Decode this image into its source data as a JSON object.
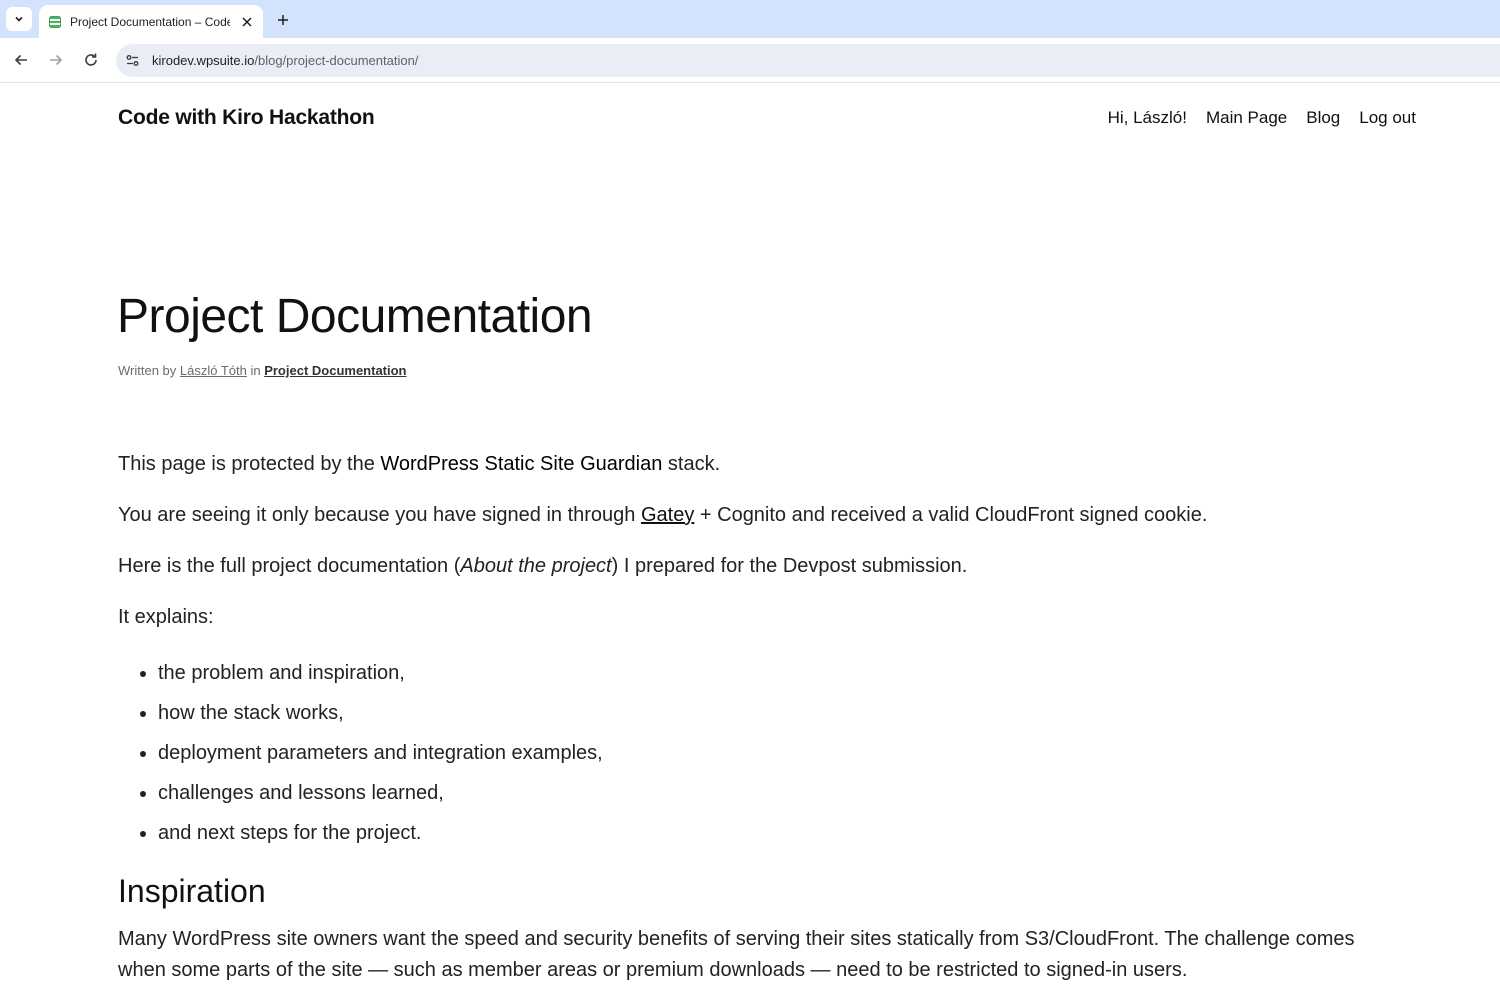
{
  "browser": {
    "tab_title": "Project Documentation – Code",
    "url_host": "kirodev.wpsuite.io",
    "url_path": "/blog/project-documentation/"
  },
  "site": {
    "title": "Code with Kiro Hackathon",
    "nav": [
      "Hi, László!",
      "Main Page",
      "Blog",
      "Log out"
    ]
  },
  "post": {
    "title": "Project Documentation",
    "meta_written_by": "Written by ",
    "meta_author": "László Tóth",
    "meta_in": " in ",
    "meta_category": "Project Documentation"
  },
  "content": {
    "p1_a": "This page is protected by the ",
    "p1_b": "WordPress Static Site Guardian",
    "p1_c": " stack.",
    "p2_a": "You are seeing it only because you have signed in through ",
    "p2_link": "Gatey",
    "p2_b": " + Cognito and received a valid CloudFront signed cookie.",
    "p3_a": "Here is the full project documentation (",
    "p3_em": "About the project",
    "p3_b": ") I prepared for the Devpost submission.",
    "p4": "It explains:",
    "list": [
      "the problem and inspiration,",
      "how the stack works,",
      "deployment parameters and integration examples,",
      "challenges and lessons learned,",
      "and next steps for the project."
    ],
    "heading_inspiration": "Inspiration",
    "p5": "Many WordPress site owners want the speed and security benefits of serving their sites statically from S3/CloudFront. The challenge comes when some parts of the site — such as member areas or premium downloads — need to be restricted to signed-in users."
  }
}
